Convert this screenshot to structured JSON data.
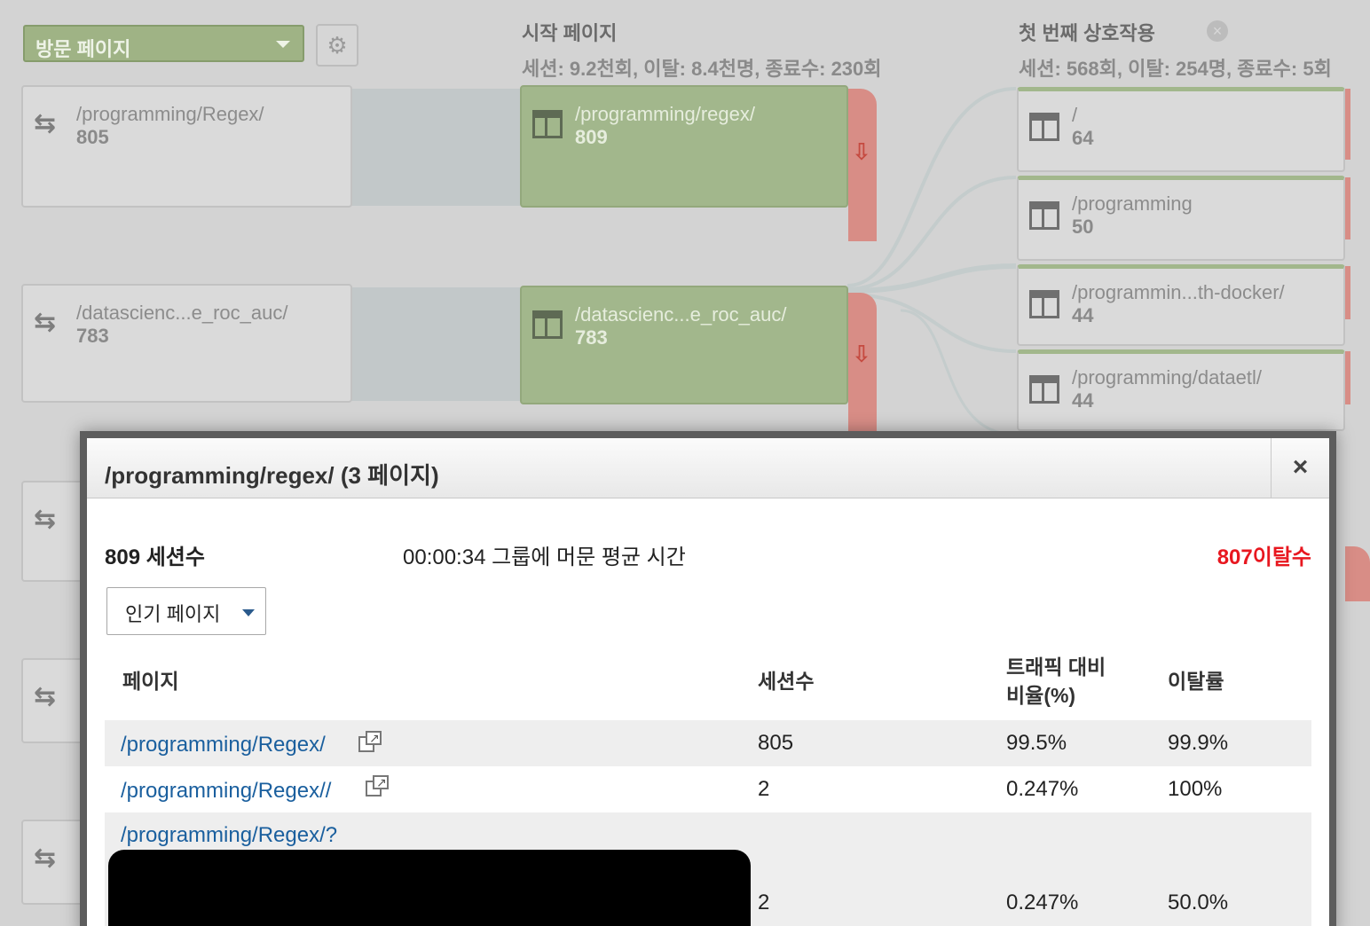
{
  "flow": {
    "dimension_select": "방문 페이지",
    "gear_icon": "gear-icon",
    "columns": [
      {
        "title": "시작 페이지",
        "subtitle": "세션: 9.2천회, 이탈: 8.4천명, 종료수: 230회"
      },
      {
        "title": "첫 번째 상호작용",
        "subtitle": "세션: 568회, 이탈: 254명, 종료수: 5회"
      }
    ],
    "landing_nodes": [
      {
        "label": "/programming/Regex/",
        "value": "805"
      },
      {
        "label": "/datascienc...e_roc_auc/",
        "value": "783"
      }
    ],
    "start_nodes": [
      {
        "label": "/programming/regex/",
        "value": "809"
      },
      {
        "label": "/datascienc...e_roc_auc/",
        "value": "783"
      }
    ],
    "interaction_nodes": [
      {
        "label": "/",
        "value": "64"
      },
      {
        "label": "/programming",
        "value": "50"
      },
      {
        "label": "/programmin...th-docker/",
        "value": "44"
      },
      {
        "label": "/programming/dataetl/",
        "value": "44"
      }
    ]
  },
  "modal": {
    "title": "/programming/regex/ (3 페이지)",
    "close_label": "×",
    "sessions": "809 세션수",
    "avg_time": "00:00:34 그룹에 머문 평균 시간",
    "exits": "807이탈수",
    "dropdown": "인기 페이지",
    "headers": {
      "page": "페이지",
      "sessions": "세션수",
      "traffic_line1": "트래픽 대비",
      "traffic_line2": "비율(%)",
      "exit_rate": "이탈률"
    },
    "rows": [
      {
        "page": "/programming/Regex/",
        "sessions": "805",
        "traffic": "99.5%",
        "exit_rate": "99.9%"
      },
      {
        "page": "/programming/Regex//",
        "sessions": "2",
        "traffic": "0.247%",
        "exit_rate": "100%"
      },
      {
        "page": "/programming/Regex/?",
        "sessions": "2",
        "traffic": "0.247%",
        "exit_rate": "50.0%"
      }
    ]
  },
  "colors": {
    "accent_green": "#a2b78c",
    "exit_red": "#e8171f",
    "link_blue": "#1a5f9e"
  }
}
